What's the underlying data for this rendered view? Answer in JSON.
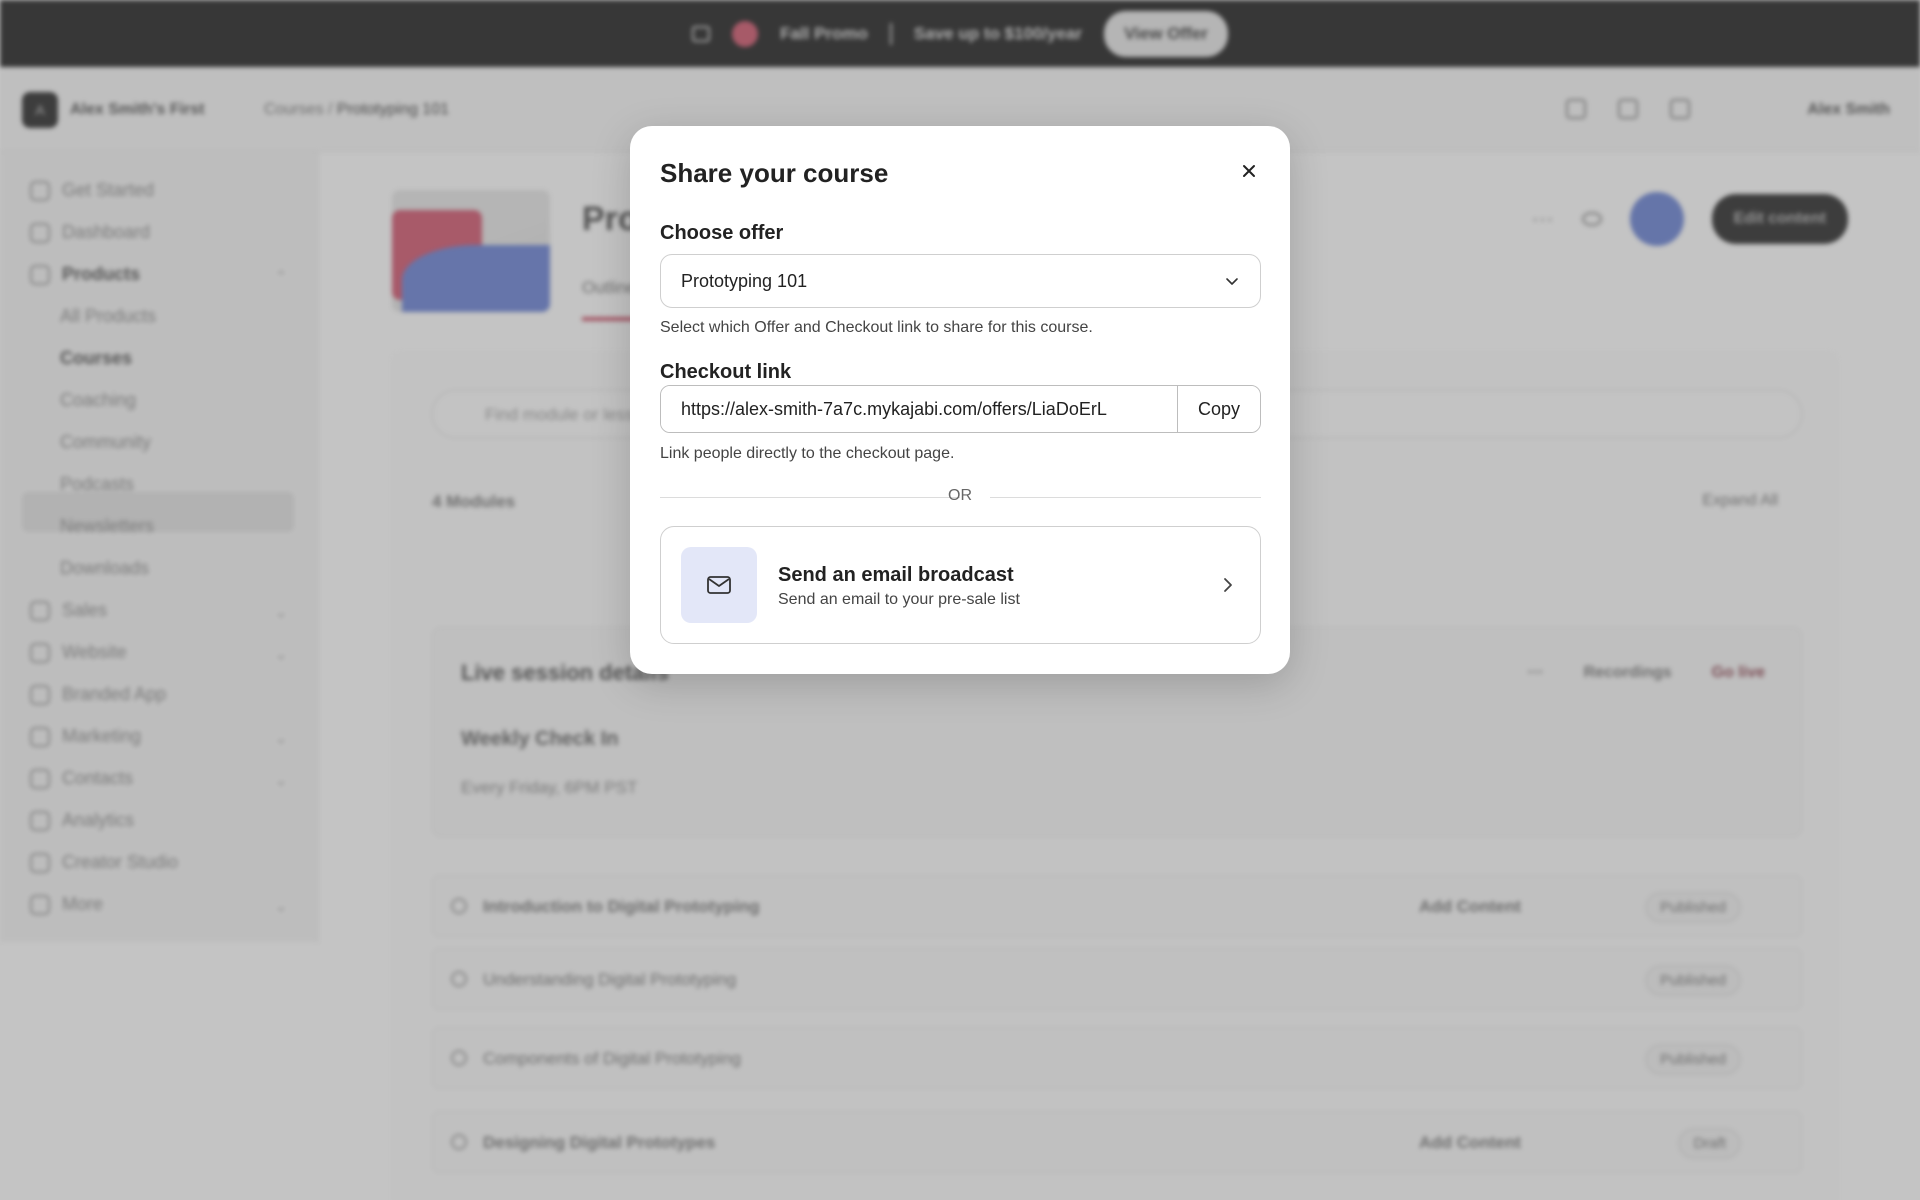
{
  "promo": {
    "brand": "Fall Promo",
    "text": "Save up to $100/year",
    "cta": "View Offer"
  },
  "topbar": {
    "logo_letter": "A",
    "site_name": "Alex Smith's First",
    "breadcrumb": [
      "Courses",
      "Prototyping 101"
    ],
    "user": "Alex Smith"
  },
  "sidebar": {
    "items": [
      {
        "label": "Get Started"
      },
      {
        "label": "Dashboard"
      },
      {
        "label": "Products"
      },
      {
        "label": "All Products"
      },
      {
        "label": "Courses"
      },
      {
        "label": "Coaching"
      },
      {
        "label": "Community"
      },
      {
        "label": "Podcasts"
      },
      {
        "label": "Newsletters"
      },
      {
        "label": "Downloads"
      },
      {
        "label": "Sales"
      },
      {
        "label": "Website"
      },
      {
        "label": "Branded App"
      },
      {
        "label": "Marketing"
      },
      {
        "label": "Contacts"
      },
      {
        "label": "Analytics"
      },
      {
        "label": "Creator Studio"
      },
      {
        "label": "More"
      }
    ]
  },
  "main": {
    "title_fragment": "Pro",
    "tab": "Outline",
    "edit_button": "Edit content",
    "search_placeholder": "Find module or lesson",
    "modules_count": "4 Modules",
    "expand_all": "Expand All",
    "live": {
      "title": "Live session details",
      "recordings": "Recordings",
      "go_live": "Go live",
      "session": "Weekly Check In",
      "schedule": "Every Friday, 6PM PST"
    },
    "modules": [
      {
        "title": "Introduction to Digital Prototyping",
        "add": "Add Content",
        "status": "Published"
      },
      {
        "title": "Understanding Digital Prototyping",
        "add": "",
        "status": "Published"
      },
      {
        "title": "Components of Digital Prototyping",
        "add": "",
        "status": "Published"
      },
      {
        "title": "Designing Digital Prototypes",
        "add": "Add Content",
        "status": "Draft"
      }
    ]
  },
  "modal": {
    "title": "Share your course",
    "offer_label": "Choose offer",
    "offer_value": "Prototyping 101",
    "offer_help": "Select which Offer and Checkout link to share for this course.",
    "checkout_label": "Checkout link",
    "checkout_url": "https://alex-smith-7a7c.mykajabi.com/offers/LiaDoErL",
    "copy_label": "Copy",
    "checkout_help": "Link people directly to the checkout page.",
    "or_text": "OR",
    "broadcast_title": "Send an email broadcast",
    "broadcast_sub": "Send an email to your pre-sale list"
  },
  "colors": {
    "accent_pink": "#c0566a",
    "accent_blue": "#6a80c8",
    "email_tile": "#e3e7f8"
  }
}
